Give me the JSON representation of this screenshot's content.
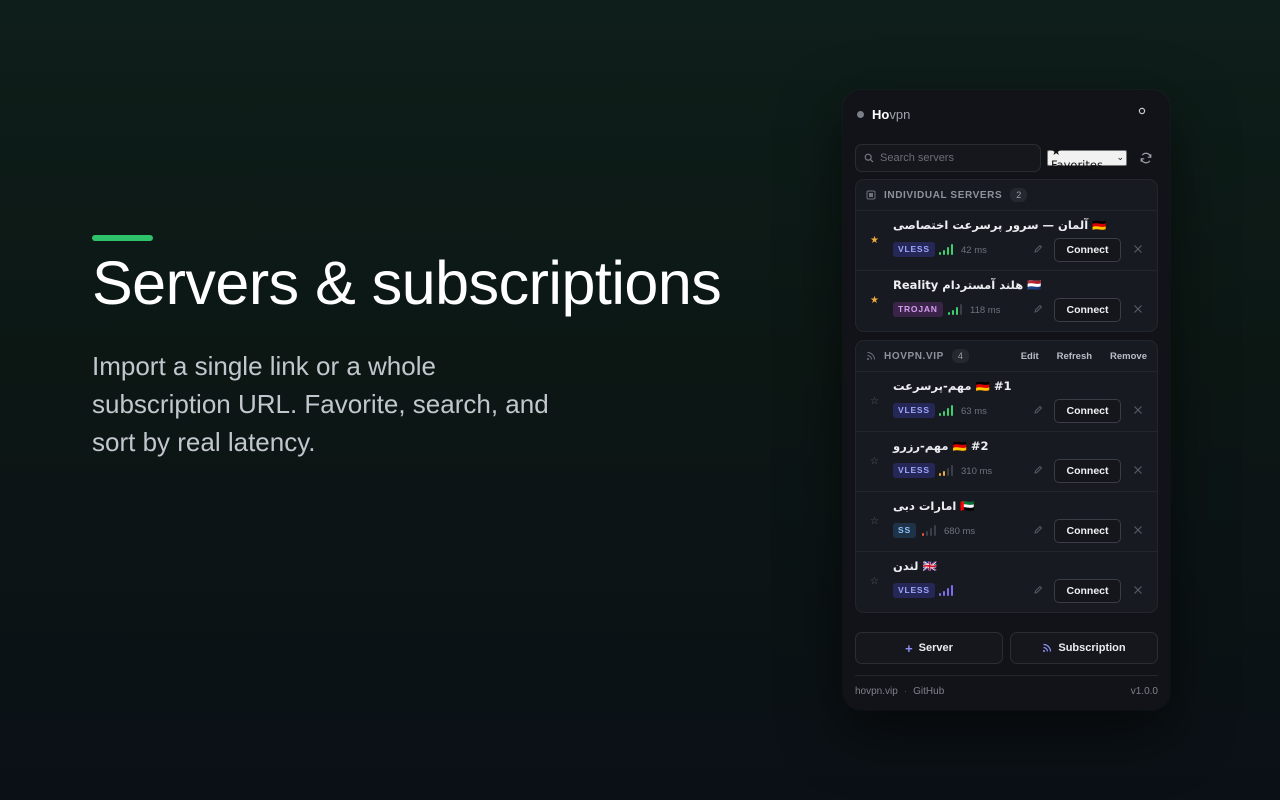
{
  "hero": {
    "title": "Servers & subscriptions",
    "subtitle": "Import a single link or a whole subscription URL. Favorite, search, and sort by real latency.",
    "accent_color": "#2ec26b"
  },
  "app": {
    "brand_bold": "Ho",
    "brand_rest": "vpn",
    "settings_icon": "gear-icon"
  },
  "toolbar": {
    "search_placeholder": "Search servers",
    "filter_value": "★ Favorites",
    "refresh_icon": "refresh-icon"
  },
  "groups": [
    {
      "title": "INDIVIDUAL SERVERS",
      "count": "2",
      "servers": [
        {
          "name": "🇩🇪 آلمان — سرور پرسرعت اختصاصی",
          "favorite": true,
          "protocol": "VLESS",
          "latency": "42 ms",
          "signal_bars": 4,
          "signal_color": "#3ccf6e"
        },
        {
          "name": "🇳🇱 هلند آمستردام Reality",
          "favorite": true,
          "protocol": "TROJAN",
          "latency": "118 ms",
          "signal_bars": 3,
          "signal_color": "#3ccf6e"
        }
      ]
    },
    {
      "title": "HOVPN.VIP",
      "count": "4",
      "actions": [
        "Edit",
        "Refresh",
        "Remove"
      ],
      "servers": [
        {
          "name": "#1 🇩🇪 مهم-پرسرعت",
          "favorite": false,
          "protocol": "VLESS",
          "latency": "63 ms",
          "signal_bars": 4,
          "signal_color": "#3ccf6e"
        },
        {
          "name": "#2 🇩🇪 مهم-رزرو",
          "favorite": false,
          "protocol": "VLESS",
          "latency": "310 ms",
          "signal_bars": 2,
          "signal_color": "#f0a93b"
        },
        {
          "name": "🇦🇪 امارات دبی",
          "favorite": false,
          "protocol": "SS",
          "latency": "680 ms",
          "signal_bars": 1,
          "signal_color": "#e8553b"
        },
        {
          "name": "🇬🇧 لندن",
          "favorite": false,
          "protocol": "VLESS",
          "latency": "",
          "signal_bars": 4,
          "signal_color": "#7c6cf0"
        }
      ]
    }
  ],
  "connect_label": "Connect",
  "bottom": {
    "add_server": "Server",
    "add_subscription": "Subscription"
  },
  "footer": {
    "site": "hovpn.vip",
    "github": "GitHub",
    "version": "v1.0.0"
  }
}
